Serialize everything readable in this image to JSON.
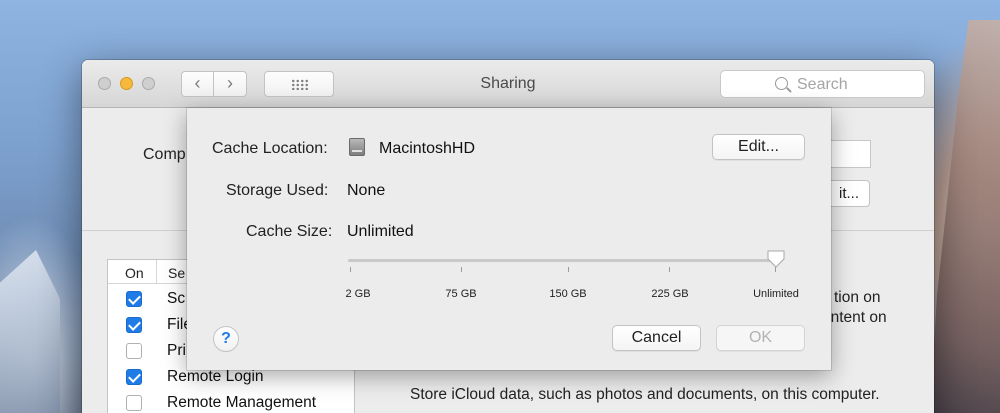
{
  "window": {
    "title": "Sharing",
    "search_placeholder": "Search",
    "computer_name_label": "Comp",
    "edit_label_partial": "it..."
  },
  "services": {
    "header_on": "On",
    "header_service": "Se",
    "items": [
      {
        "name": "Sc",
        "on": true
      },
      {
        "name": "File",
        "on": true
      },
      {
        "name": "Pri",
        "on": false
      },
      {
        "name": "Remote Login",
        "on": true
      },
      {
        "name": "Remote Management",
        "on": false
      }
    ]
  },
  "right_panel": {
    "line1": "tion on",
    "line2": "ontent on",
    "icloud_text": "Store iCloud data, such as photos and documents, on this computer."
  },
  "dialog": {
    "cache_location_label": "Cache Location:",
    "cache_location_value": "MacintoshHD",
    "edit_button": "Edit...",
    "storage_used_label": "Storage Used:",
    "storage_used_value": "None",
    "cache_size_label": "Cache Size:",
    "cache_size_value": "Unlimited",
    "slider": {
      "ticks": [
        "2 GB",
        "75 GB",
        "150 GB",
        "225 GB",
        "Unlimited"
      ],
      "selected_index": 4
    },
    "help_label": "?",
    "cancel_button": "Cancel",
    "ok_button": "OK"
  },
  "colors": {
    "accent": "#1f7be6",
    "minimize": "#f6b93b"
  }
}
